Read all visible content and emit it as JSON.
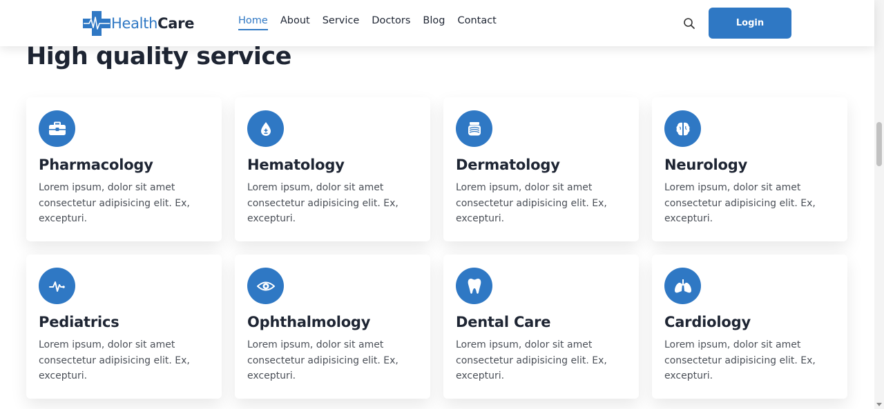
{
  "brand": {
    "name_part1": "Health",
    "name_part2": "Care"
  },
  "nav": {
    "links": [
      "Home",
      "About",
      "Service",
      "Doctors",
      "Blog",
      "Contact"
    ],
    "active": "Home",
    "login_label": "Login"
  },
  "colors": {
    "accent": "#2f78c4",
    "text": "#1e2533",
    "body_text": "#4a4f57"
  },
  "section": {
    "title": "High quality service"
  },
  "services": [
    {
      "title": "Pharmacology",
      "icon": "medical-kit-icon",
      "text": "Lorem ipsum, dolor sit amet consectetur adipisicing elit. Ex, excepturi."
    },
    {
      "title": "Hematology",
      "icon": "blood-drop-icon",
      "text": "Lorem ipsum, dolor sit amet consectetur adipisicing elit. Ex, excepturi."
    },
    {
      "title": "Dermatology",
      "icon": "skin-jar-icon",
      "text": "Lorem ipsum, dolor sit amet consectetur adipisicing elit. Ex, excepturi."
    },
    {
      "title": "Neurology",
      "icon": "brain-icon",
      "text": "Lorem ipsum, dolor sit amet consectetur adipisicing elit. Ex, excepturi."
    },
    {
      "title": "Pediatrics",
      "icon": "heartbeat-icon",
      "text": "Lorem ipsum, dolor sit amet consectetur adipisicing elit. Ex, excepturi."
    },
    {
      "title": "Ophthalmology",
      "icon": "eye-icon",
      "text": "Lorem ipsum, dolor sit amet consectetur adipisicing elit. Ex, excepturi."
    },
    {
      "title": "Dental Care",
      "icon": "tooth-icon",
      "text": "Lorem ipsum, dolor sit amet consectetur adipisicing elit. Ex, excepturi."
    },
    {
      "title": "Cardiology",
      "icon": "lungs-icon",
      "text": "Lorem ipsum, dolor sit amet consectetur adipisicing elit. Ex, excepturi."
    }
  ]
}
